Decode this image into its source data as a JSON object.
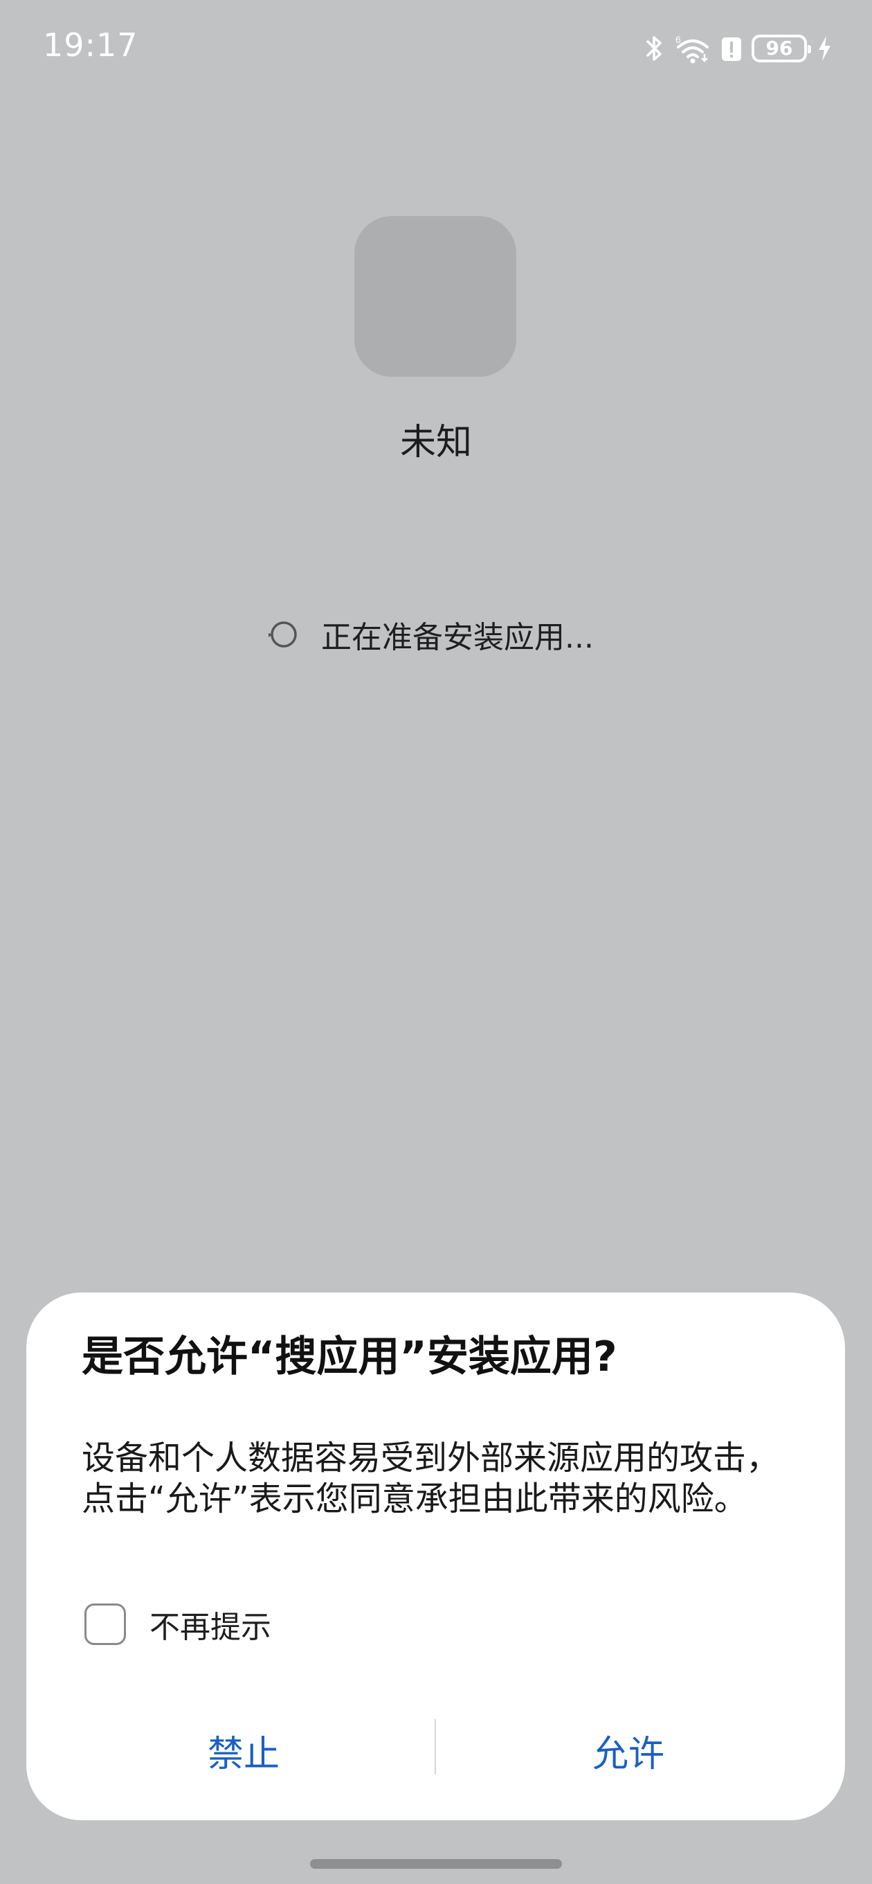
{
  "status_bar": {
    "time": "19:17",
    "battery": "96",
    "icons": [
      "bluetooth-icon",
      "wifi-icon",
      "alert-icon",
      "battery-icon",
      "charging-icon"
    ]
  },
  "installer": {
    "app_name": "未知",
    "preparing_text": "正在准备安装应用..."
  },
  "dialog": {
    "title": "是否允许“搜应用”安装应用?",
    "message": "设备和个人数据容易受到外部来源应用的攻击，点击“允许”表示您同意承担由此带来的风险。",
    "checkbox_label": "不再提示",
    "checkbox_checked": false,
    "deny_label": "禁止",
    "allow_label": "允许"
  },
  "colors": {
    "background": "#c1c2c4",
    "accent": "#1a5fc4",
    "dialog": "#ffffff"
  }
}
